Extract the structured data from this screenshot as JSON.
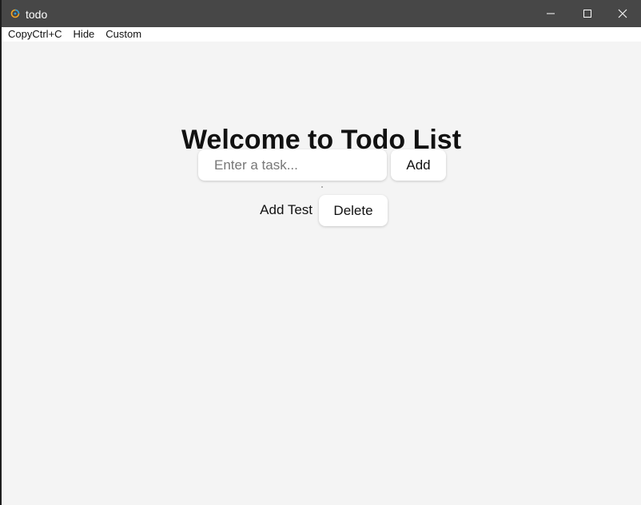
{
  "window": {
    "title": "todo",
    "app_icon": "app-logo-icon",
    "controls": {
      "minimize_icon": "minimize-icon",
      "maximize_icon": "maximize-icon",
      "close_icon": "close-icon"
    }
  },
  "menu": {
    "items": [
      {
        "label": "CopyCtrl+C"
      },
      {
        "label": "Hide"
      },
      {
        "label": "Custom"
      }
    ]
  },
  "main": {
    "heading": "Welcome to Todo List",
    "task_input": {
      "value": "",
      "placeholder": "Enter a task..."
    },
    "add_button_label": "Add",
    "todos": [
      {
        "text": "Add Test",
        "delete_label": "Delete"
      }
    ]
  },
  "colors": {
    "titlebar": "#474747",
    "background": "#f4f4f4",
    "menubar": "#ffffff"
  }
}
